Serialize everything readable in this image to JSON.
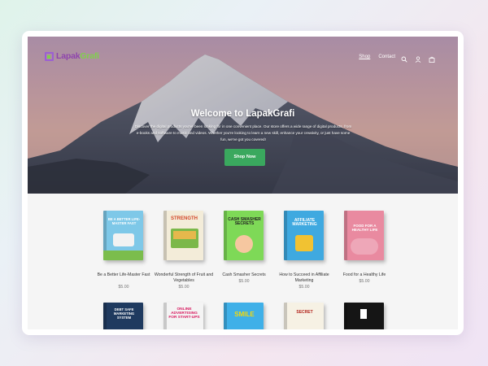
{
  "header": {
    "logo_prefix": "Lapak",
    "logo_suffix": "Grafi",
    "nav": [
      {
        "label": "Shop"
      },
      {
        "label": "Contact"
      }
    ],
    "icons": [
      "search-icon",
      "account-icon",
      "cart-icon"
    ]
  },
  "hero": {
    "title": "Welcome to LapakGrafi",
    "description": "Discover the digital products you've been looking for in one convenient place. Our store offers a wide range of digital products, from e-books and software to music and videos. Whether you're looking to learn a new skill, enhance your creativity, or just have some fun, we've got you covered!",
    "cta": "Shop Now"
  },
  "products": [
    {
      "name": "Be a Better Life-Master Fast",
      "price": "$5.00",
      "cover_title": "BE A BETTER LIFE-MASTER FAST",
      "cover_color": "#7ec8e8"
    },
    {
      "name": "Wonderful Strength of Fruit and Vegetables",
      "price": "$5.00",
      "cover_title": "STRENGTH",
      "cover_color": "#f3ecd9"
    },
    {
      "name": "Cash Smasher Secrets",
      "price": "$5.00",
      "cover_title": "CASH SMASHER SECRETS",
      "cover_color": "#7ed957"
    },
    {
      "name": "How to Succeed in Affiliate Marketing",
      "price": "$5.00",
      "cover_title": "AFFILIATE MARKETING",
      "cover_color": "#3fa9e0"
    },
    {
      "name": "Food for a Healthy Life",
      "price": "$5.00",
      "cover_title": "FOOD FOR A HEALTHY LIFE",
      "cover_color": "#e98aa0"
    }
  ],
  "products_row2": [
    {
      "cover_title": "DEBT SAFE MARKETING SYSTEM",
      "cover_color": "#1f3a5f"
    },
    {
      "cover_title": "ONLINE ADVERTISING FOR START-UPS",
      "cover_color": "#f4f4f4"
    },
    {
      "cover_title": "SMILE",
      "cover_color": "#3fb0e8"
    },
    {
      "cover_title": "SECRET",
      "cover_color": "#f6f1e4"
    },
    {
      "cover_title": "",
      "cover_color": "#151515"
    }
  ]
}
